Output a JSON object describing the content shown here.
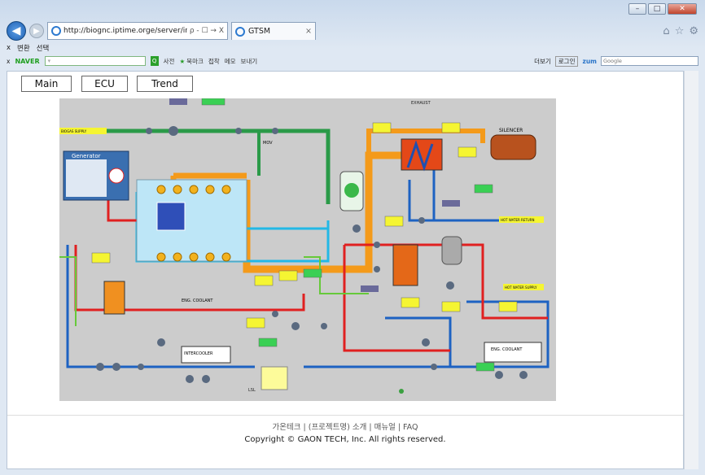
{
  "browser": {
    "url": "http://biognc.iptime.orge/server/inde",
    "tab_title": "GTSM",
    "address_tools": "ρ - ☐ → X",
    "cmd_convert": "변환",
    "cmd_select": "선택",
    "naver_logo": "NAVER",
    "naver_items": [
      "사전",
      "북마크",
      "접착",
      "메모",
      "보내기"
    ],
    "more_label": "더보기",
    "login_label": "로그인",
    "zum_label": "zum",
    "google_placeholder": "Google"
  },
  "nav": {
    "buttons": [
      {
        "label": "Main"
      },
      {
        "label": "ECU"
      },
      {
        "label": "Trend"
      }
    ]
  },
  "diagram": {
    "generator_title": "Generator",
    "silencer": "SILENCER",
    "exhaust": "EXHAUST",
    "eng_coolant": "ENG. COOLANT",
    "hot_water_supply": "HOT WATER SUPPLY",
    "hot_water_return": "HOT WATER RETURN",
    "intercooler": "INTERCOOLER",
    "eng_coolant_box": "ENG. COOLANT",
    "mov": "MOV",
    "biogas": "BIOGAS SUPPLY",
    "lsl": "LSL"
  },
  "footer": {
    "links": "가온테크 | (프로젝트명) 소개 | 매뉴얼 | FAQ",
    "copyright": "Copyright © GAON TECH, Inc. All rights reserved."
  }
}
